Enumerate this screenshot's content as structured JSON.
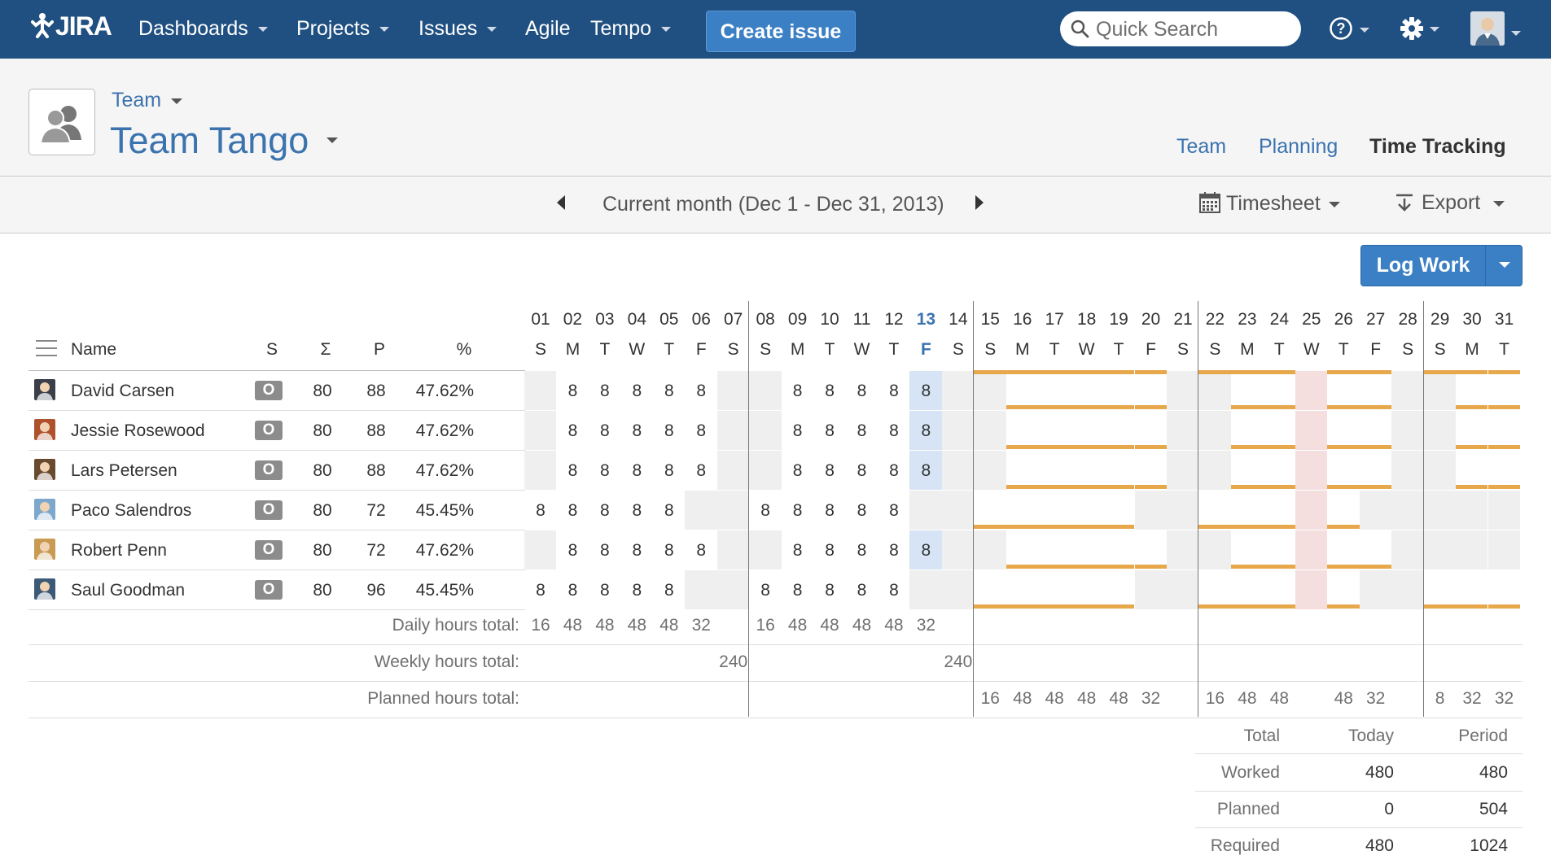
{
  "nav": {
    "logo": "JIRA",
    "items": [
      {
        "label": "Dashboards",
        "has_caret": true
      },
      {
        "label": "Projects",
        "has_caret": true
      },
      {
        "label": "Issues",
        "has_caret": true
      },
      {
        "label": "Agile",
        "has_caret": false
      },
      {
        "label": "Tempo",
        "has_caret": true
      }
    ],
    "create_label": "Create issue",
    "search_placeholder": "Quick Search",
    "help_icon": "help-icon",
    "settings_icon": "gear-icon",
    "colors": {
      "bar": "#205081",
      "create": "#3b7fc4"
    }
  },
  "header": {
    "breadcrumb": "Team",
    "team_name": "Team Tango",
    "tabs": [
      {
        "label": "Team",
        "active": false
      },
      {
        "label": "Planning",
        "active": false
      },
      {
        "label": "Time Tracking",
        "active": true
      }
    ]
  },
  "period": {
    "label": "Current month (Dec 1 - Dec 31, 2013)",
    "timesheet_label": "Timesheet",
    "export_label": "Export"
  },
  "log_work_label": "Log Work",
  "grid": {
    "columns": {
      "name": "Name",
      "s": "S",
      "sum": "Σ",
      "p": "P",
      "pct": "%"
    },
    "today": 13,
    "days": [
      {
        "d": "01",
        "w": "S"
      },
      {
        "d": "02",
        "w": "M"
      },
      {
        "d": "03",
        "w": "T"
      },
      {
        "d": "04",
        "w": "W"
      },
      {
        "d": "05",
        "w": "T"
      },
      {
        "d": "06",
        "w": "F"
      },
      {
        "d": "07",
        "w": "S"
      },
      {
        "d": "08",
        "w": "S"
      },
      {
        "d": "09",
        "w": "M"
      },
      {
        "d": "10",
        "w": "T"
      },
      {
        "d": "11",
        "w": "W"
      },
      {
        "d": "12",
        "w": "T"
      },
      {
        "d": "13",
        "w": "F"
      },
      {
        "d": "14",
        "w": "S"
      },
      {
        "d": "15",
        "w": "S"
      },
      {
        "d": "16",
        "w": "M"
      },
      {
        "d": "17",
        "w": "T"
      },
      {
        "d": "18",
        "w": "W"
      },
      {
        "d": "19",
        "w": "T"
      },
      {
        "d": "20",
        "w": "F"
      },
      {
        "d": "21",
        "w": "S"
      },
      {
        "d": "22",
        "w": "S"
      },
      {
        "d": "23",
        "w": "M"
      },
      {
        "d": "24",
        "w": "T"
      },
      {
        "d": "25",
        "w": "W"
      },
      {
        "d": "26",
        "w": "T"
      },
      {
        "d": "27",
        "w": "F"
      },
      {
        "d": "28",
        "w": "S"
      },
      {
        "d": "29",
        "w": "S"
      },
      {
        "d": "30",
        "w": "M"
      },
      {
        "d": "31",
        "w": "T"
      }
    ],
    "rows": [
      {
        "name": "David Carsen",
        "status": "O",
        "sum": "80",
        "p": "88",
        "pct": "47.62%",
        "avatar_color": "#3a3f4a",
        "hours": {
          "2": "8",
          "3": "8",
          "4": "8",
          "5": "8",
          "6": "8",
          "9": "8",
          "10": "8",
          "11": "8",
          "12": "8",
          "13": "8"
        },
        "off_days": [
          1,
          7,
          8,
          14
        ],
        "planned_days": [
          16,
          17,
          18,
          19,
          20,
          23,
          24,
          26,
          27,
          30,
          31
        ],
        "top_days": [
          15,
          16,
          17,
          18,
          19,
          20,
          22,
          23,
          24,
          26,
          27
        ]
      },
      {
        "name": "Jessie Rosewood",
        "status": "O",
        "sum": "80",
        "p": "88",
        "pct": "47.62%",
        "avatar_color": "#b0512d",
        "hours": {
          "2": "8",
          "3": "8",
          "4": "8",
          "5": "8",
          "6": "8",
          "9": "8",
          "10": "8",
          "11": "8",
          "12": "8",
          "13": "8"
        },
        "off_days": [
          1,
          7,
          8,
          14
        ],
        "planned_days": [
          16,
          17,
          18,
          19,
          20,
          23,
          24,
          26,
          27,
          30,
          31
        ],
        "top_days": []
      },
      {
        "name": "Lars Petersen",
        "status": "O",
        "sum": "80",
        "p": "88",
        "pct": "47.62%",
        "avatar_color": "#6a4a2e",
        "hours": {
          "2": "8",
          "3": "8",
          "4": "8",
          "5": "8",
          "6": "8",
          "9": "8",
          "10": "8",
          "11": "8",
          "12": "8",
          "13": "8"
        },
        "off_days": [
          1,
          7,
          8,
          14
        ],
        "planned_days": [
          16,
          17,
          18,
          19,
          20,
          23,
          24,
          26,
          27,
          30,
          31
        ],
        "top_days": []
      },
      {
        "name": "Paco Salendros",
        "status": "O",
        "sum": "80",
        "p": "72",
        "pct": "45.45%",
        "avatar_color": "#7ea7cc",
        "hours": {
          "1": "8",
          "2": "8",
          "3": "8",
          "4": "8",
          "5": "8",
          "8": "8",
          "9": "8",
          "10": "8",
          "11": "8",
          "12": "8"
        },
        "off_days": [
          6,
          7,
          13,
          14
        ],
        "planned_days": [
          15,
          16,
          17,
          18,
          19,
          22,
          23,
          24,
          26
        ],
        "top_days": []
      },
      {
        "name": "Robert Penn",
        "status": "O",
        "sum": "80",
        "p": "72",
        "pct": "47.62%",
        "avatar_color": "#c89a52",
        "hours": {
          "2": "8",
          "3": "8",
          "4": "8",
          "5": "8",
          "6": "8",
          "9": "8",
          "10": "8",
          "11": "8",
          "12": "8",
          "13": "8"
        },
        "off_days": [
          1,
          7,
          8,
          14
        ],
        "planned_days": [
          16,
          17,
          18,
          19,
          20,
          23,
          24,
          26,
          27
        ],
        "top_days": []
      },
      {
        "name": "Saul Goodman",
        "status": "O",
        "sum": "80",
        "p": "96",
        "pct": "45.45%",
        "avatar_color": "#3c5a78",
        "hours": {
          "1": "8",
          "2": "8",
          "3": "8",
          "4": "8",
          "5": "8",
          "8": "8",
          "9": "8",
          "10": "8",
          "11": "8",
          "12": "8"
        },
        "off_days": [
          6,
          7,
          13,
          14
        ],
        "planned_days": [
          15,
          16,
          17,
          18,
          19,
          22,
          23,
          24,
          26,
          29,
          30,
          31
        ],
        "top_days": []
      }
    ],
    "totals": {
      "daily_label": "Daily hours total:",
      "daily": {
        "1": "16",
        "2": "48",
        "3": "48",
        "4": "48",
        "5": "48",
        "6": "32",
        "8": "16",
        "9": "48",
        "10": "48",
        "11": "48",
        "12": "48",
        "13": "32"
      },
      "weekly_label": "Weekly hours total:",
      "weekly": {
        "7": "240",
        "14": "240"
      },
      "planned_label": "Planned hours total:",
      "planned": {
        "15": "16",
        "16": "48",
        "17": "48",
        "18": "48",
        "19": "48",
        "20": "32",
        "22": "16",
        "23": "48",
        "24": "48",
        "26": "48",
        "27": "32",
        "29": "8",
        "30": "32",
        "31": "32"
      }
    },
    "holiday_day": 25
  },
  "summary": {
    "headers": [
      "Total",
      "Today",
      "Period"
    ],
    "rows": [
      {
        "label": "Worked",
        "today": "480",
        "period": "480"
      },
      {
        "label": "Planned",
        "today": "0",
        "period": "504"
      },
      {
        "label": "Required",
        "today": "480",
        "period": "1024"
      }
    ]
  }
}
